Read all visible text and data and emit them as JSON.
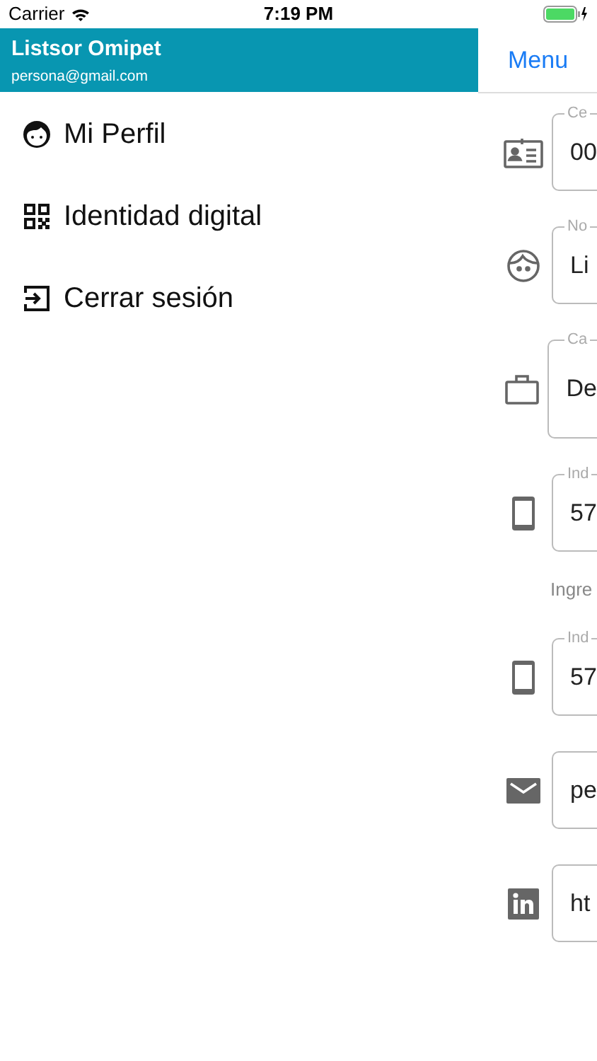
{
  "status_bar": {
    "carrier": "Carrier",
    "time": "7:19 PM"
  },
  "drawer": {
    "user_name": "Listsor Omipet",
    "user_email": "persona@gmail.com",
    "items": [
      {
        "label": "Mi Perfil",
        "kind": "profile"
      },
      {
        "label": "Identidad digital",
        "kind": "qr"
      },
      {
        "label": "Cerrar sesión",
        "kind": "logout"
      }
    ]
  },
  "main": {
    "nav_title": "Menu",
    "rows": [
      {
        "kind": "idcard",
        "label": "Ce",
        "value": "00"
      },
      {
        "kind": "name",
        "label": "No",
        "value": "Li"
      },
      {
        "kind": "job",
        "label": "Ca",
        "value": "De"
      },
      {
        "kind": "phone",
        "label": "Ind",
        "value": "57"
      },
      {
        "kind": "hint",
        "text": "Ingre"
      },
      {
        "kind": "phone",
        "label": "Ind",
        "value": "57"
      },
      {
        "kind": "email",
        "value": "pe"
      },
      {
        "kind": "linkedin",
        "value": "ht"
      }
    ]
  }
}
